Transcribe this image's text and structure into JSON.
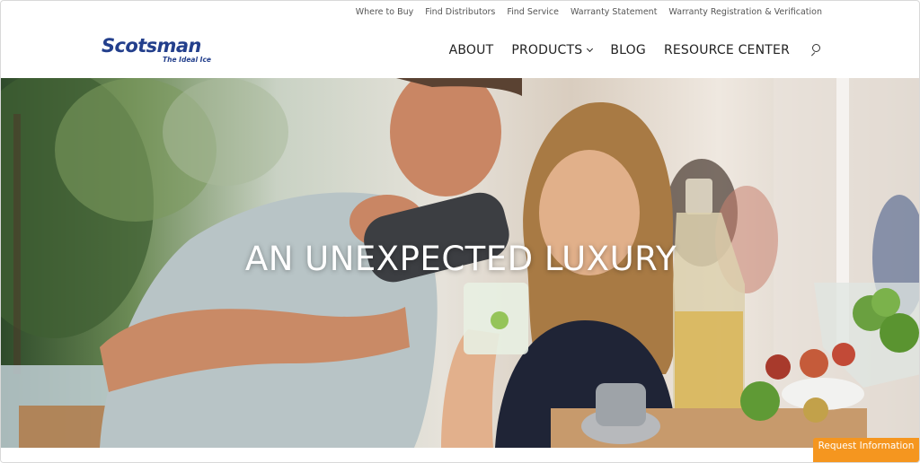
{
  "utility_nav": [
    "Where to Buy",
    "Find Distributors",
    "Find Service",
    "Warranty Statement",
    "Warranty Registration & Verification"
  ],
  "logo": {
    "name": "Scotsman",
    "tagline": "The Ideal Ice"
  },
  "main_nav": {
    "about": "ABOUT",
    "products": "PRODUCTS",
    "blog": "BLOG",
    "resource_center": "RESOURCE CENTER"
  },
  "hero": {
    "title": "AN UNEXPECTED LUXURY",
    "image": "photo of a smiling man pouring a cocktail from a shaker for a smiling woman holding a glass of ice, friends and a bowl of limes in the background"
  },
  "cta": {
    "label": "Request Information"
  },
  "colors": {
    "brand": "#233f8c",
    "cta": "#f5961f"
  },
  "icons": {
    "search": "search-icon",
    "dropdown": "chevron-down-icon"
  }
}
